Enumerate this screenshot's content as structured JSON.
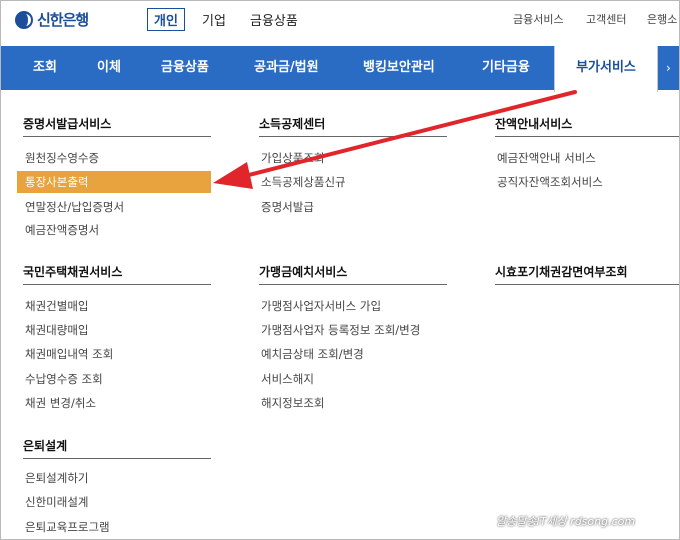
{
  "brand": {
    "name": "신한은행"
  },
  "top_tabs": [
    "개인",
    "기업",
    "금융상품"
  ],
  "utility_links": [
    "금융서비스",
    "고객센터",
    "은행소"
  ],
  "nav": {
    "items": [
      "조회",
      "이체",
      "금융상품",
      "공과금/법원",
      "뱅킹보안관리",
      "기타금융",
      "부가서비스"
    ],
    "active_index": 6
  },
  "sections": {
    "cert": {
      "title": "증명서발급서비스",
      "items": [
        "원천징수영수증",
        "통장사본출력",
        "연말정산/납입증명서",
        "예금잔액증명서"
      ],
      "highlight": 1
    },
    "tax": {
      "title": "소득공제센터",
      "items": [
        "가입상품조회",
        "소득공제상품신규",
        "증명서발급"
      ]
    },
    "balance": {
      "title": "잔액안내서비스",
      "items": [
        "예금잔액안내 서비스",
        "공직자잔액조회서비스"
      ]
    },
    "bond": {
      "title": "국민주택채권서비스",
      "items": [
        "채권건별매입",
        "채권대량매입",
        "채권매입내역 조회",
        "수납영수증 조회",
        "채권 변경/취소"
      ]
    },
    "merchant": {
      "title": "가맹금예치서비스",
      "items": [
        "가맹점사업자서비스 가입",
        "가맹점사업자 등록정보 조회/변경",
        "예치금상태 조회/변경",
        "서비스해지",
        "해지정보조회"
      ]
    },
    "limitation": {
      "title": "시효포기채권감면여부조회",
      "items": []
    },
    "retire": {
      "title": "은퇴설계",
      "items": [
        "은퇴설계하기",
        "신한미래설계",
        "은퇴교육프로그램"
      ]
    }
  },
  "colors": {
    "nav_bg": "#2a6bc4",
    "highlight": "#e8a23e",
    "arrow": "#e0262b",
    "brand": "#1b4f9c"
  },
  "watermark": "알송달송IT세상 rdsong.com"
}
